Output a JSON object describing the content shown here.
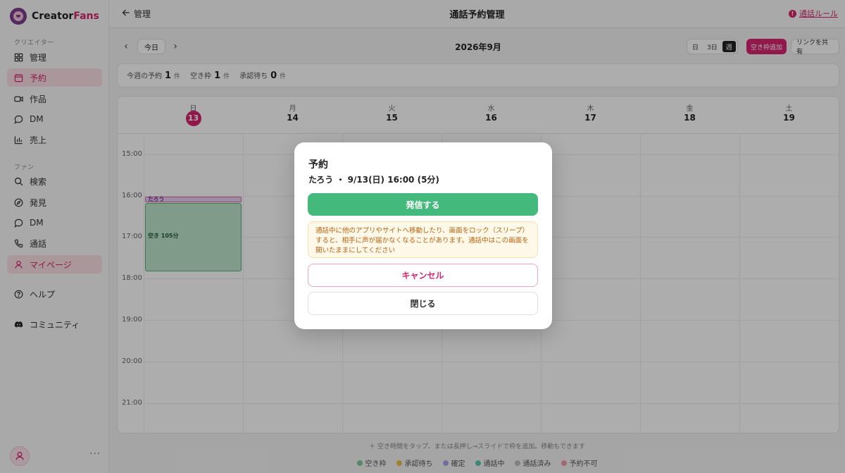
{
  "app": {
    "logo_prefix": "Creator",
    "logo_suffix": "Fans",
    "brand_color": "#d6246e"
  },
  "sidebar": {
    "creator_label": "クリエイター",
    "fan_label": "ファン",
    "creator_items": [
      {
        "label": "管理",
        "icon": "grid-icon"
      },
      {
        "label": "予約",
        "icon": "calendar-icon",
        "active": true
      },
      {
        "label": "作品",
        "icon": "video-icon"
      },
      {
        "label": "DM",
        "icon": "chat-icon"
      },
      {
        "label": "売上",
        "icon": "bar-chart-icon"
      }
    ],
    "fan_items": [
      {
        "label": "検索",
        "icon": "search-icon"
      },
      {
        "label": "発見",
        "icon": "compass-icon"
      },
      {
        "label": "DM",
        "icon": "chat-icon"
      },
      {
        "label": "通話",
        "icon": "phone-icon"
      },
      {
        "label": "マイページ",
        "icon": "user-icon",
        "active": true
      }
    ],
    "help": "ヘルプ",
    "community": "コミュニティ",
    "more": "···"
  },
  "header": {
    "back_label": "管理",
    "title": "通話予約管理",
    "rules_link": "通話ルール",
    "rules_badge": "!"
  },
  "toolbar": {
    "prev": "‹",
    "next": "›",
    "today": "今日",
    "month": "2026年9月",
    "views": [
      "日",
      "3日",
      "週"
    ],
    "active_view": "週",
    "add_slot": "空き枠追加",
    "share_link": "リンクを共有"
  },
  "stats": {
    "week_bookings_label": "今週の予約",
    "week_bookings_value": "1",
    "free_slots_label": "空き枠",
    "free_slots_value": "1",
    "pending_label": "承認待ち",
    "pending_value": "0",
    "unit": "件"
  },
  "calendar": {
    "days": [
      {
        "name": "日",
        "num": "13",
        "today": true
      },
      {
        "name": "月",
        "num": "14"
      },
      {
        "name": "火",
        "num": "15"
      },
      {
        "name": "水",
        "num": "16"
      },
      {
        "name": "木",
        "num": "17"
      },
      {
        "name": "金",
        "num": "18"
      },
      {
        "name": "土",
        "num": "19"
      }
    ],
    "hours": [
      "15:00",
      "16:00",
      "17:00",
      "18:00",
      "19:00",
      "20:00",
      "21:00"
    ],
    "booked_label": "たろう",
    "free_label": "空き 105分"
  },
  "footer": {
    "hint": "＋ 空き時間をタップ、または長押し→スライドで枠を追加。移動もできます",
    "legend": [
      {
        "label": "空き枠",
        "color": "#7cc89c"
      },
      {
        "label": "承認待ち",
        "color": "#e8c04a"
      },
      {
        "label": "確定",
        "color": "#a9a4e8"
      },
      {
        "label": "通話中",
        "color": "#5cc7a8"
      },
      {
        "label": "通話済み",
        "color": "#bdbdbd"
      },
      {
        "label": "予約不可",
        "color": "#ef9aaa"
      }
    ]
  },
  "modal": {
    "title": "予約",
    "subtitle": "たろう ・ 9/13(日) 16:00 (5分)",
    "call_button": "発信する",
    "warning": "通話中に他のアプリやサイトへ移動したり、画面をロック（スリープ）すると、相手に声が届かなくなることがあります。通話中はこの画面を開いたままにしてください",
    "cancel_button": "キャンセル",
    "close_button": "閉じる"
  }
}
